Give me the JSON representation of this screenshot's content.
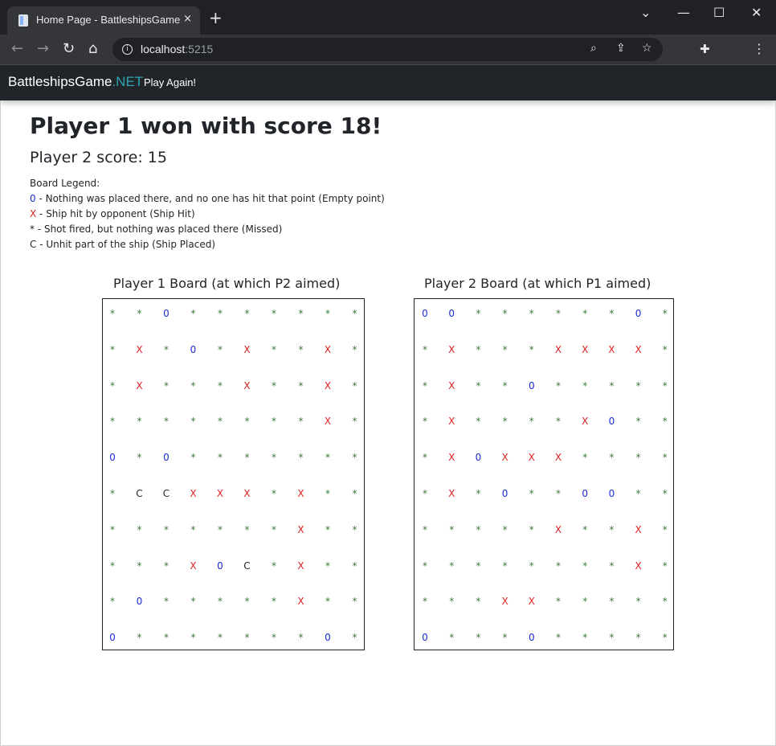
{
  "browser": {
    "tab_title": "Home Page - BattleshipsGameDc",
    "tab_close": "×",
    "new_tab": "+",
    "url_host": "localhost",
    "url_port": ":5215",
    "window_controls": {
      "minimize": "—",
      "maximize": "☐",
      "close": "✕",
      "tab_list": "⌄"
    }
  },
  "navbar": {
    "brand_main": "BattleshipsGame",
    "brand_accent": ".NET",
    "play_again": "Play Again!"
  },
  "result": {
    "winner_text": "Player 1 won with score 18!",
    "loser_text": "Player 2 score: 15"
  },
  "legend": {
    "title": "Board Legend:",
    "items": [
      {
        "symbol": "0",
        "text": " - Nothing was placed there, and no one has hit that point (Empty point)"
      },
      {
        "symbol": "X",
        "text": " - Ship hit by opponent (Ship Hit)"
      },
      {
        "symbol": "*",
        "text": " - Shot fired, but nothing was placed there (Missed)"
      },
      {
        "symbol": "C",
        "text": " - Unhit part of the ship (Ship Placed)"
      }
    ]
  },
  "boards": [
    {
      "title": "Player 1 Board (at which P2 aimed)",
      "rows": [
        [
          "*",
          "*",
          "0",
          "*",
          "*",
          "*",
          "*",
          "*",
          "*",
          "*"
        ],
        [
          "*",
          "X",
          "*",
          "0",
          "*",
          "X",
          "*",
          "*",
          "X",
          "*"
        ],
        [
          "*",
          "X",
          "*",
          "*",
          "*",
          "X",
          "*",
          "*",
          "X",
          "*"
        ],
        [
          "*",
          "*",
          "*",
          "*",
          "*",
          "*",
          "*",
          "*",
          "X",
          "*"
        ],
        [
          "0",
          "*",
          "0",
          "*",
          "*",
          "*",
          "*",
          "*",
          "*",
          "*"
        ],
        [
          "*",
          "C",
          "C",
          "X",
          "X",
          "X",
          "*",
          "X",
          "*",
          "*"
        ],
        [
          "*",
          "*",
          "*",
          "*",
          "*",
          "*",
          "*",
          "X",
          "*",
          "*"
        ],
        [
          "*",
          "*",
          "*",
          "X",
          "0",
          "C",
          "*",
          "X",
          "*",
          "*"
        ],
        [
          "*",
          "0",
          "*",
          "*",
          "*",
          "*",
          "*",
          "X",
          "*",
          "*"
        ],
        [
          "0",
          "*",
          "*",
          "*",
          "*",
          "*",
          "*",
          "*",
          "0",
          "*"
        ]
      ]
    },
    {
      "title": "Player 2 Board (at which P1 aimed)",
      "rows": [
        [
          "0",
          "0",
          "*",
          "*",
          "*",
          "*",
          "*",
          "*",
          "0",
          "*"
        ],
        [
          "*",
          "X",
          "*",
          "*",
          "*",
          "X",
          "X",
          "X",
          "X",
          "*"
        ],
        [
          "*",
          "X",
          "*",
          "*",
          "0",
          "*",
          "*",
          "*",
          "*",
          "*"
        ],
        [
          "*",
          "X",
          "*",
          "*",
          "*",
          "*",
          "X",
          "0",
          "*",
          "*"
        ],
        [
          "*",
          "X",
          "0",
          "X",
          "X",
          "X",
          "*",
          "*",
          "*",
          "*"
        ],
        [
          "*",
          "X",
          "*",
          "0",
          "*",
          "*",
          "0",
          "0",
          "*",
          "*"
        ],
        [
          "*",
          "*",
          "*",
          "*",
          "*",
          "X",
          "*",
          "*",
          "X",
          "*"
        ],
        [
          "*",
          "*",
          "*",
          "*",
          "*",
          "*",
          "*",
          "*",
          "X",
          "*"
        ],
        [
          "*",
          "*",
          "*",
          "X",
          "X",
          "*",
          "*",
          "*",
          "*",
          "*"
        ],
        [
          "0",
          "*",
          "*",
          "*",
          "0",
          "*",
          "*",
          "*",
          "*",
          "*"
        ]
      ]
    }
  ],
  "colors": {
    "empty": "#1a2bd6",
    "hit": "#e02020",
    "miss": "#3a7a3a",
    "placed": "#212529"
  }
}
